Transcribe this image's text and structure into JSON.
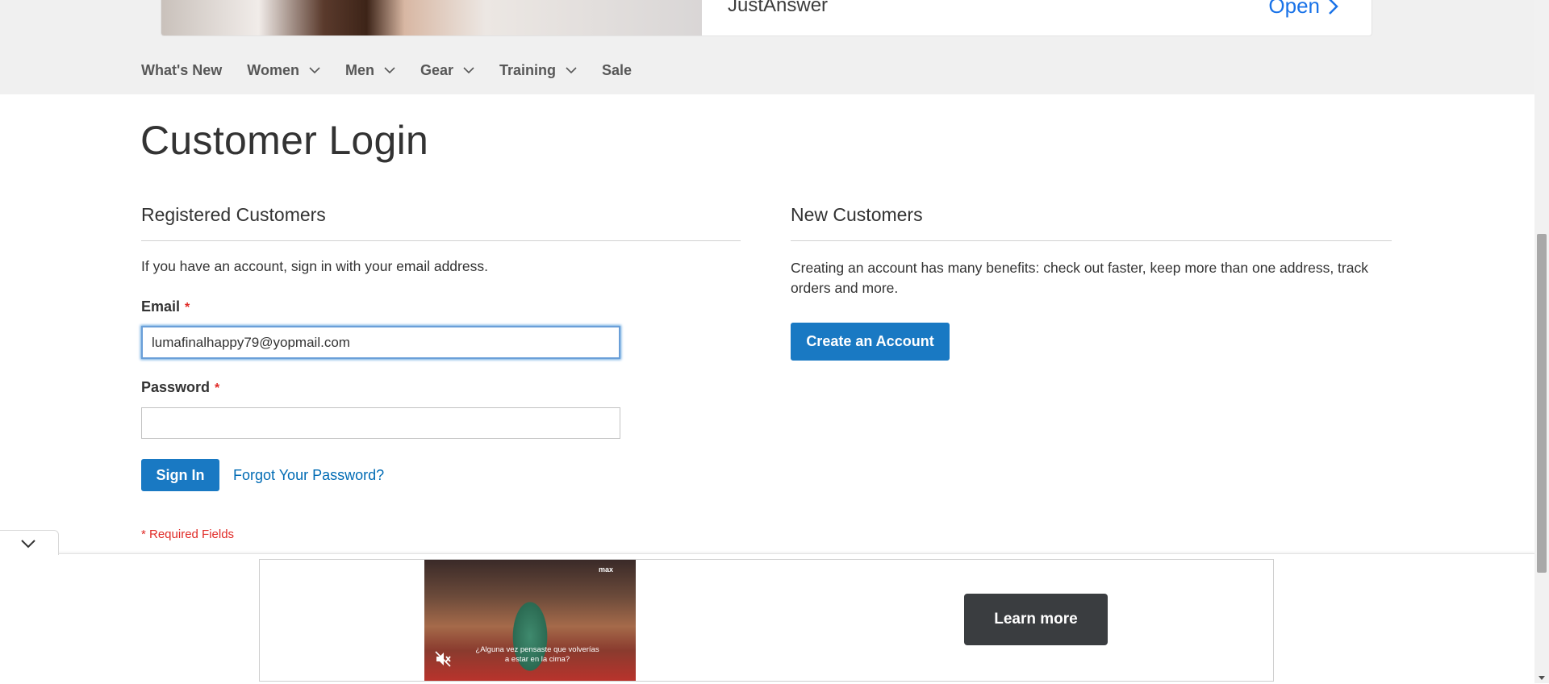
{
  "top_ad": {
    "brand": "JustAnswer",
    "open_label": "Open"
  },
  "nav": {
    "items": [
      {
        "label": "What's New",
        "has_dropdown": false
      },
      {
        "label": "Women",
        "has_dropdown": true
      },
      {
        "label": "Men",
        "has_dropdown": true
      },
      {
        "label": "Gear",
        "has_dropdown": true
      },
      {
        "label": "Training",
        "has_dropdown": true
      },
      {
        "label": "Sale",
        "has_dropdown": false
      }
    ]
  },
  "page": {
    "title": "Customer Login"
  },
  "registered": {
    "title": "Registered Customers",
    "intro": "If you have an account, sign in with your email address.",
    "email_label": "Email",
    "email_value": "lumafinalhappy79@yopmail.com",
    "password_label": "Password",
    "password_value": "",
    "required_mark": "*",
    "sign_in_label": "Sign In",
    "forgot_label": "Forgot Your Password?",
    "required_note": "* Required Fields"
  },
  "new_customers": {
    "title": "New Customers",
    "text": "Creating an account has many benefits: check out faster, keep more than one address, track orders and more.",
    "create_label": "Create an Account"
  },
  "bottom_ad": {
    "video_brand": "max",
    "video_caption": "¿Alguna vez pensaste que volverías a estar en la cima?",
    "learn_more_label": "Learn more"
  },
  "colors": {
    "primary": "#1979c3",
    "link": "#006bb4",
    "required": "#e02b27",
    "nav_band": "#f0f0f0",
    "ad_button": "#3a3d40"
  },
  "icons": {
    "nav_dropdown": "chevron-down-icon",
    "ad_open": "chevron-right-icon",
    "collapse": "chevron-down-icon",
    "video_mute": "mute-icon"
  }
}
